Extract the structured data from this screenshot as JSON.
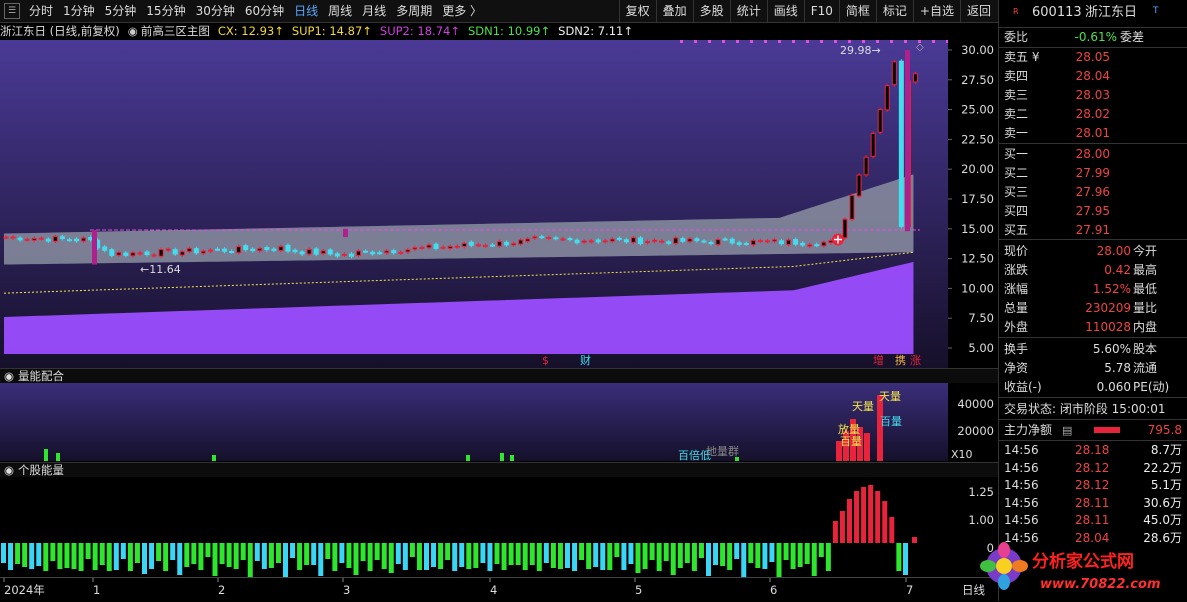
{
  "toolbar": {
    "left_items": [
      "分时",
      "1分钟",
      "5分钟",
      "15分钟",
      "30分钟",
      "60分钟",
      "日线",
      "周线",
      "月线",
      "多周期",
      "更多 〉"
    ],
    "active": "日线",
    "right_items": [
      "复权",
      "叠加",
      "多股",
      "统计",
      "画线",
      "F10",
      "简框",
      "标记",
      "+自选",
      "返回"
    ]
  },
  "info": {
    "name": "浙江东日 (日线,前复权)",
    "indicator": "前高三区主图",
    "cx": "CX: 12.93↑",
    "sup1": "SUP1: 14.87↑",
    "sup2": "SUP2: 18.74↑",
    "sdn1": "SDN1: 10.99↑",
    "sdn2": "SDN2: 7.11↑"
  },
  "panels": {
    "vol_title": "量能配合",
    "ind_title": "个股能量",
    "vol_scale": "X10"
  },
  "colors": {
    "up": "#e8233c",
    "down": "#44ddee",
    "band": "#8a8fa0",
    "purple": "#9b4dff",
    "green": "#2ee62e",
    "cyan": "#3ad6f5"
  },
  "chart_data": {
    "type": "candlestick",
    "ylim": [
      5,
      30.5
    ],
    "yticks": [
      "30.00",
      "27.50",
      "25.00",
      "22.50",
      "20.00",
      "17.50",
      "15.00",
      "12.50",
      "10.00",
      "7.50",
      "5.00"
    ],
    "xticks": [
      "2024年",
      "1",
      "2",
      "3",
      "4",
      "5",
      "6",
      "7"
    ],
    "annotations": {
      "high": "29.98",
      "low": "11.64"
    },
    "event_labels": [
      "$",
      "财",
      "增",
      "携",
      "涨"
    ],
    "volume": {
      "yticks": [
        "40000",
        "20000"
      ],
      "labels": [
        "天量",
        "百量",
        "天量",
        "百量",
        "百倍低",
        "地量群",
        "放量"
      ]
    },
    "energy": {
      "yticks": [
        "1.25",
        "1.00",
        "0"
      ]
    },
    "x_last_label": "日线"
  },
  "quote": {
    "code": "600113",
    "name": "浙江东日",
    "weibi_label": "委比",
    "weibi": "-0.61%",
    "weicha_label": "委差",
    "asks": [
      [
        "卖五 ¥",
        "28.05"
      ],
      [
        "卖四",
        "28.04"
      ],
      [
        "卖三",
        "28.03"
      ],
      [
        "卖二",
        "28.02"
      ],
      [
        "卖一",
        "28.01"
      ]
    ],
    "bids": [
      [
        "买一",
        "28.00"
      ],
      [
        "买二",
        "27.99"
      ],
      [
        "买三",
        "27.96"
      ],
      [
        "买四",
        "27.95"
      ],
      [
        "买五",
        "27.91"
      ]
    ],
    "stats": [
      [
        "现价",
        "28.00",
        "今开",
        ""
      ],
      [
        "涨跌",
        "0.42",
        "最高",
        ""
      ],
      [
        "涨幅",
        "1.52%",
        "最低",
        ""
      ],
      [
        "总量",
        "230209",
        "量比",
        ""
      ],
      [
        "外盘",
        "110028",
        "内盘",
        ""
      ]
    ],
    "stats2": [
      [
        "换手",
        "5.60%",
        "股本",
        ""
      ],
      [
        "净资",
        "5.78",
        "流通",
        ""
      ],
      [
        "收益(-)",
        "0.060",
        "PE(动)",
        ""
      ]
    ],
    "status": "交易状态: 闭市阶段 15:00:01",
    "main_net_label": "主力净额",
    "main_net": "795.8",
    "ticks": [
      [
        "14:56",
        "28.18",
        "8.7万"
      ],
      [
        "14:56",
        "28.12",
        "22.2万"
      ],
      [
        "14:56",
        "28.12",
        "5.1万"
      ],
      [
        "14:56",
        "28.11",
        "30.6万"
      ],
      [
        "14:56",
        "28.11",
        "45.0万"
      ],
      [
        "14:56",
        "28.04",
        "28.6万"
      ]
    ]
  },
  "watermark": {
    "title": "分析家公式网",
    "url": "www.70822.com"
  }
}
